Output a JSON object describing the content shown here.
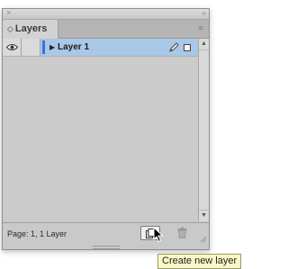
{
  "panel": {
    "tab_label": "Layers",
    "tab_arrows": "◇",
    "collapse_glyph": "»",
    "close_glyph": "×",
    "menu_icon": "≡"
  },
  "layers": [
    {
      "name": "Layer 1",
      "visible": true,
      "selected": true,
      "color": "#3f6fd8",
      "disclosure_glyph": "▶"
    }
  ],
  "footer": {
    "status": "Page: 1, 1 Layer"
  },
  "tooltip": {
    "text": "Create new layer"
  },
  "scroll": {
    "up_glyph": "▲",
    "down_glyph": "▼"
  },
  "colors": {
    "panel_bg": "#c8c8c8",
    "selection": "#a9c8e6",
    "layer_color": "#3f6fd8",
    "tooltip_bg": "#f9f7c8"
  }
}
